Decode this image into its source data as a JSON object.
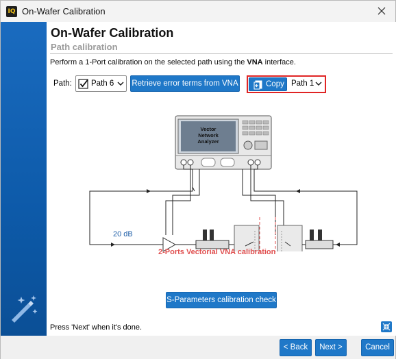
{
  "window": {
    "app_icon": "IQ",
    "title": "On-Wafer Calibration"
  },
  "header": {
    "title": "On-Wafer Calibration",
    "subtitle": "Path calibration"
  },
  "instructions": {
    "before": "Perform a 1-Port calibration on the selected path using the ",
    "bold": "VNA",
    "after": " interface."
  },
  "path_row": {
    "label": "Path:",
    "selected_path": "Path 6",
    "retrieve_label": "Retrieve error terms from VNA",
    "copy_label": "Copy",
    "copy_target": "Path 1"
  },
  "diagram": {
    "vna_text": [
      "Vector",
      "Network",
      "Analyzer"
    ],
    "amp_gain": "20 dB",
    "caption": "2-Ports Vectorial VNA calibration"
  },
  "sparam_label": "S-Parameters calibration check",
  "status_text": "Press 'Next' when it's done.",
  "footer": {
    "back_label": "< Back",
    "next_label": "Next >",
    "cancel_label": "Cancel"
  },
  "colors": {
    "accent": "#1f78c8",
    "sidebar": "#0d5aa9",
    "highlight": "#e02424",
    "caption": "#e05050"
  },
  "icons": [
    "close-icon",
    "checkbox-icon",
    "chevron-down-icon",
    "copy-icon",
    "magic-wand-icon",
    "collapse-icon"
  ]
}
